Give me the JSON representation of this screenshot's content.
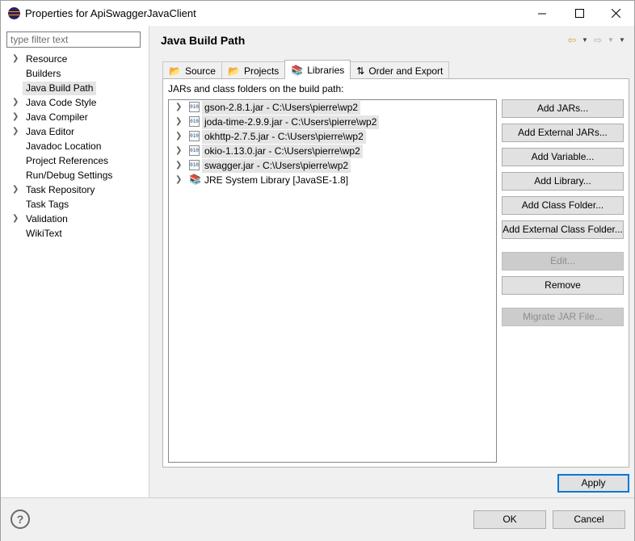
{
  "window": {
    "title": "Properties for ApiSwaggerJavaClient",
    "min_icon": "minimize-icon",
    "max_icon": "maximize-icon",
    "close_icon": "close-icon"
  },
  "filter": {
    "placeholder": "type filter text",
    "value": ""
  },
  "tree": {
    "items": [
      {
        "label": "Resource",
        "expandable": true,
        "selected": false
      },
      {
        "label": "Builders",
        "expandable": false,
        "selected": false
      },
      {
        "label": "Java Build Path",
        "expandable": false,
        "selected": true
      },
      {
        "label": "Java Code Style",
        "expandable": true,
        "selected": false
      },
      {
        "label": "Java Compiler",
        "expandable": true,
        "selected": false
      },
      {
        "label": "Java Editor",
        "expandable": true,
        "selected": false
      },
      {
        "label": "Javadoc Location",
        "expandable": false,
        "selected": false
      },
      {
        "label": "Project References",
        "expandable": false,
        "selected": false
      },
      {
        "label": "Run/Debug Settings",
        "expandable": false,
        "selected": false
      },
      {
        "label": "Task Repository",
        "expandable": true,
        "selected": false
      },
      {
        "label": "Task Tags",
        "expandable": false,
        "selected": false
      },
      {
        "label": "Validation",
        "expandable": true,
        "selected": false
      },
      {
        "label": "WikiText",
        "expandable": false,
        "selected": false
      }
    ]
  },
  "page": {
    "title": "Java Build Path"
  },
  "tabs": [
    {
      "label": "Source",
      "icon": "source-folder-icon",
      "active": false
    },
    {
      "label": "Projects",
      "icon": "projects-icon",
      "active": false
    },
    {
      "label": "Libraries",
      "icon": "libraries-icon",
      "active": true
    },
    {
      "label": "Order and Export",
      "icon": "order-export-icon",
      "active": false
    }
  ],
  "libraries": {
    "caption": "JARs and class folders on the build path:",
    "items": [
      {
        "label": "gson-2.8.1.jar - C:\\Users\\pierre\\wp2",
        "icon": "jar-icon",
        "highlight": true
      },
      {
        "label": "joda-time-2.9.9.jar - C:\\Users\\pierre\\wp2",
        "icon": "jar-icon",
        "highlight": true
      },
      {
        "label": "okhttp-2.7.5.jar - C:\\Users\\pierre\\wp2",
        "icon": "jar-icon",
        "highlight": true
      },
      {
        "label": "okio-1.13.0.jar - C:\\Users\\pierre\\wp2",
        "icon": "jar-icon",
        "highlight": true
      },
      {
        "label": "swagger.jar - C:\\Users\\pierre\\wp2",
        "icon": "jar-icon",
        "highlight": true
      },
      {
        "label": "JRE System Library [JavaSE-1.8]",
        "icon": "jre-library-icon",
        "highlight": false
      }
    ]
  },
  "buttons": {
    "add_jars": "Add JARs...",
    "add_external_jars": "Add External JARs...",
    "add_variable": "Add Variable...",
    "add_library": "Add Library...",
    "add_class_folder": "Add Class Folder...",
    "add_external_class_folder": "Add External Class Folder...",
    "edit": "Edit...",
    "remove": "Remove",
    "migrate_jar": "Migrate JAR File...",
    "apply": "Apply",
    "ok": "OK",
    "cancel": "Cancel"
  },
  "help": {
    "symbol": "?"
  }
}
